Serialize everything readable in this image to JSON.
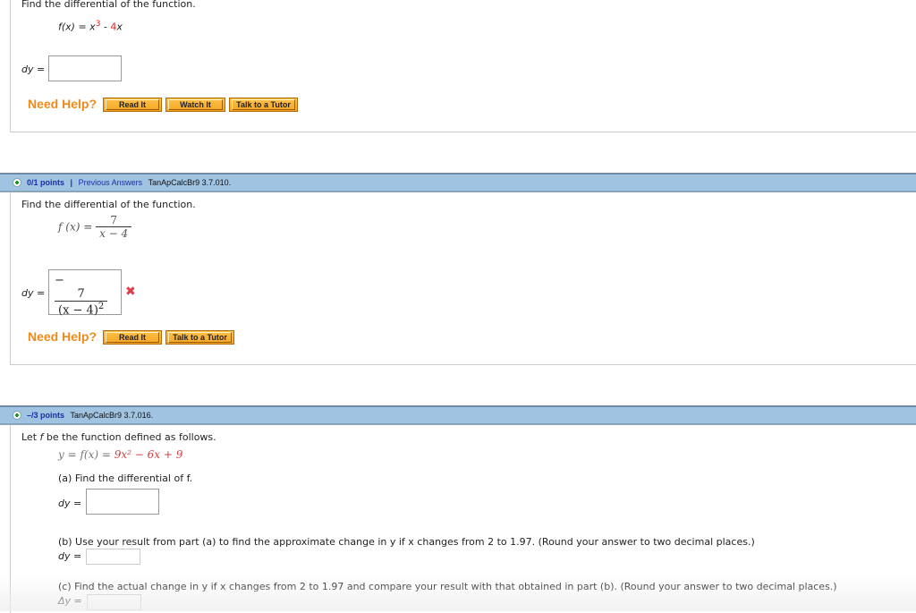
{
  "q1": {
    "prompt": "Find the differential of the function.",
    "function_lhs": "f(x) = x",
    "function_exp": "3",
    "function_mid": " - ",
    "function_coef": "4",
    "function_var": "x",
    "dy_label": "dy =",
    "dy_value": "",
    "need_help": "Need Help?",
    "buttons": [
      "Read It",
      "Watch It",
      "Talk to a Tutor"
    ]
  },
  "q2": {
    "points": "0/1 points",
    "separator": "|",
    "previous_answers": "Previous Answers",
    "code": "TanApCalcBr9 3.7.010.",
    "prompt": "Find the differential of the function.",
    "f_lhs": "f (x) =",
    "f_num": "7",
    "f_den": "x − 4",
    "dy_label": "dy =",
    "answer_sign": "−",
    "answer_num": "7",
    "answer_den": "(x − 4)",
    "answer_exp": "2",
    "answer_status": "incorrect",
    "x_icon": "✖",
    "need_help": "Need Help?",
    "buttons": [
      "Read It",
      "Talk to a Tutor"
    ]
  },
  "q3": {
    "points": "–/3 points",
    "code": "TanApCalcBr9 3.7.016.",
    "prompt_pre": "Let ",
    "prompt_f": "f",
    "prompt_post": " be the function defined as follows.",
    "func_lhs": "y = f(x) = ",
    "func_rhs": "9x² − 6x + 9",
    "part_a": "(a) Find the differential of f.",
    "part_a_label": "dy =",
    "part_a_value": "",
    "part_b": "(b) Use your result from part (a) to find the approximate change in y if x changes from 2 to 1.97. (Round your answer to two decimal places.)",
    "part_b_label": "dy =",
    "part_b_value": "",
    "part_c": "(c) Find the actual change in y if x changes from 2 to 1.97 and compare your result with that obtained in part (b). (Round your answer to two decimal places.)",
    "part_c_label": "Δy =",
    "part_c_value": ""
  }
}
